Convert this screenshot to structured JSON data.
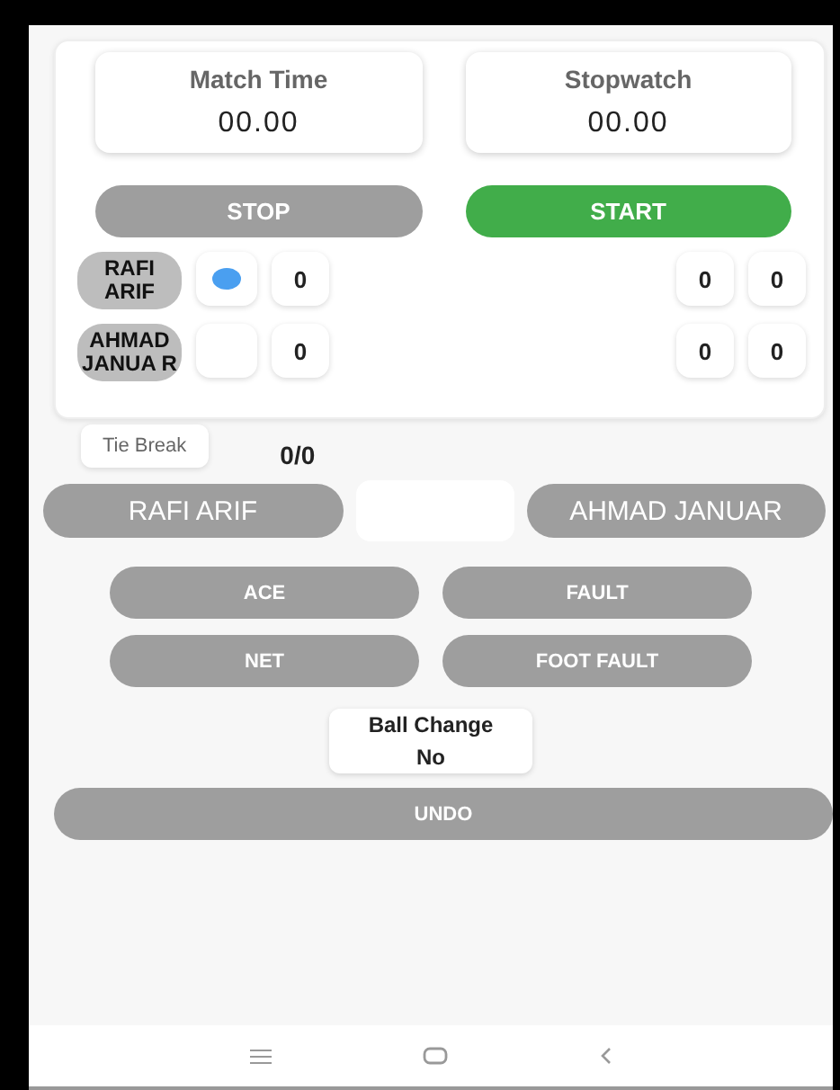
{
  "timers": [
    {
      "label": "Match Time",
      "value": "00.00"
    },
    {
      "label": "Stopwatch",
      "value": "00.00"
    }
  ],
  "clock_buttons": [
    {
      "label": "STOP",
      "kind": "inactive"
    },
    {
      "label": "START",
      "kind": "active"
    }
  ],
  "players": [
    {
      "name": "RAFI ARIF",
      "serving": true,
      "points": "0",
      "games": "0",
      "sets": "0"
    },
    {
      "name": "AHMAD JANUA R",
      "serving": false,
      "points": "0",
      "games": "0",
      "sets": "0"
    }
  ],
  "tie_break": {
    "label": "Tie Break",
    "score": "0/0"
  },
  "player_buttons": [
    "RAFI ARIF",
    "AHMAD JANUAR"
  ],
  "actions": [
    "ACE",
    "FAULT",
    "NET",
    "FOOT FAULT"
  ],
  "ball_change": {
    "label": "Ball Change",
    "value": "No"
  },
  "undo": "UNDO"
}
